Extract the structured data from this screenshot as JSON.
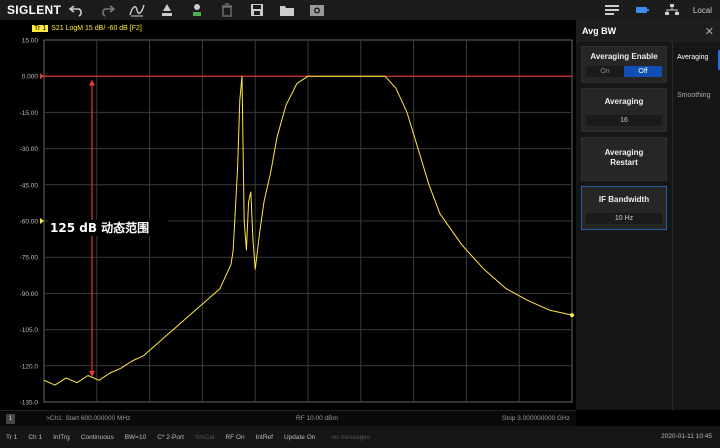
{
  "app": {
    "brand": "SIGLENT",
    "local_label": "Local"
  },
  "toolbar": {
    "icons": [
      "undo-icon",
      "redo-icon",
      "auto-scale-icon",
      "marker-icon",
      "calibrate-icon",
      "delete-icon",
      "save-icon",
      "open-folder-icon",
      "screenshot-icon"
    ],
    "right_icons": [
      "display-icon",
      "battery-icon",
      "network-icon"
    ]
  },
  "trace": {
    "badge": "Tr 1",
    "title": "S21 LogM 15 dB/ -60 dB [F2]",
    "color": "#ffeb3b"
  },
  "plot": {
    "y_ticks": [
      "15.00",
      "0.000",
      "-15.00",
      "-30.00",
      "-45.00",
      "-60.00",
      "-75.00",
      "-90.00",
      "-105.0",
      "-120.0",
      "-135.0"
    ],
    "annotation": "125 dB 动态范围",
    "reference_line_color": "#e53935"
  },
  "chart_data": {
    "type": "line",
    "title": "S21 LogM 15 dB/ -60 dB [F2]",
    "xlabel": "",
    "ylabel": "",
    "x_range_mhz": [
      600,
      3000
    ],
    "ylim": [
      -135,
      15
    ],
    "grid": true,
    "series": [
      {
        "x": [
          600,
          650,
          700,
          750,
          800,
          850,
          900,
          950,
          1000,
          1050,
          1100,
          1150,
          1200,
          1250,
          1300,
          1350,
          1400,
          1430,
          1450,
          1460,
          1470,
          1480,
          1490,
          1500,
          1510,
          1520,
          1530,
          1540,
          1550,
          1560,
          1580,
          1600,
          1630,
          1660,
          1700,
          1750,
          1800,
          1850,
          1900,
          2000,
          2100,
          2150,
          2200,
          2250,
          2300,
          2350,
          2400,
          2500,
          2600,
          2700,
          2800,
          2900,
          3000
        ],
        "y": [
          -126,
          -128,
          -125,
          -127,
          -124,
          -126,
          -123,
          -121,
          -118,
          -116,
          -112,
          -108,
          -104,
          -100,
          -96,
          -92,
          -88,
          -82,
          -78,
          -72,
          -55,
          -38,
          -10,
          0,
          -60,
          -72,
          -52,
          -48,
          -68,
          -80,
          -65,
          -52,
          -40,
          -25,
          -12,
          -3,
          0,
          0,
          0,
          0,
          0,
          0,
          -5,
          -15,
          -30,
          -45,
          -57,
          -70,
          -80,
          -88,
          -93,
          -97,
          -99
        ]
      }
    ]
  },
  "panel": {
    "title": "Avg BW",
    "averaging_enable_label": "Averaging Enable",
    "on_label": "On",
    "off_label": "Off",
    "averaging_label": "Averaging",
    "averaging_value": "16",
    "averaging_restart_label": "Averaging Restart",
    "if_bandwidth_label": "IF Bandwidth",
    "if_bandwidth_value": "10 Hz",
    "tabs": [
      "Averaging",
      "Smoothing"
    ]
  },
  "status": {
    "channel_badge": "1",
    "start": ">Ch1: Start 600.000000 MHz",
    "rf": "RF 10.00 dBm",
    "stop": "Stop 3.000000000 GHz"
  },
  "bottom_bar": {
    "items": [
      "Tr 1",
      "Ch 1",
      "IntTrg",
      "Continuous",
      "BW=10",
      "C* 2-Port",
      "SmCal",
      "RF On",
      "IntRef",
      "Update On",
      "no messages"
    ],
    "dim_items": [
      6,
      10
    ],
    "datetime": "2020-01-11 10:45"
  }
}
